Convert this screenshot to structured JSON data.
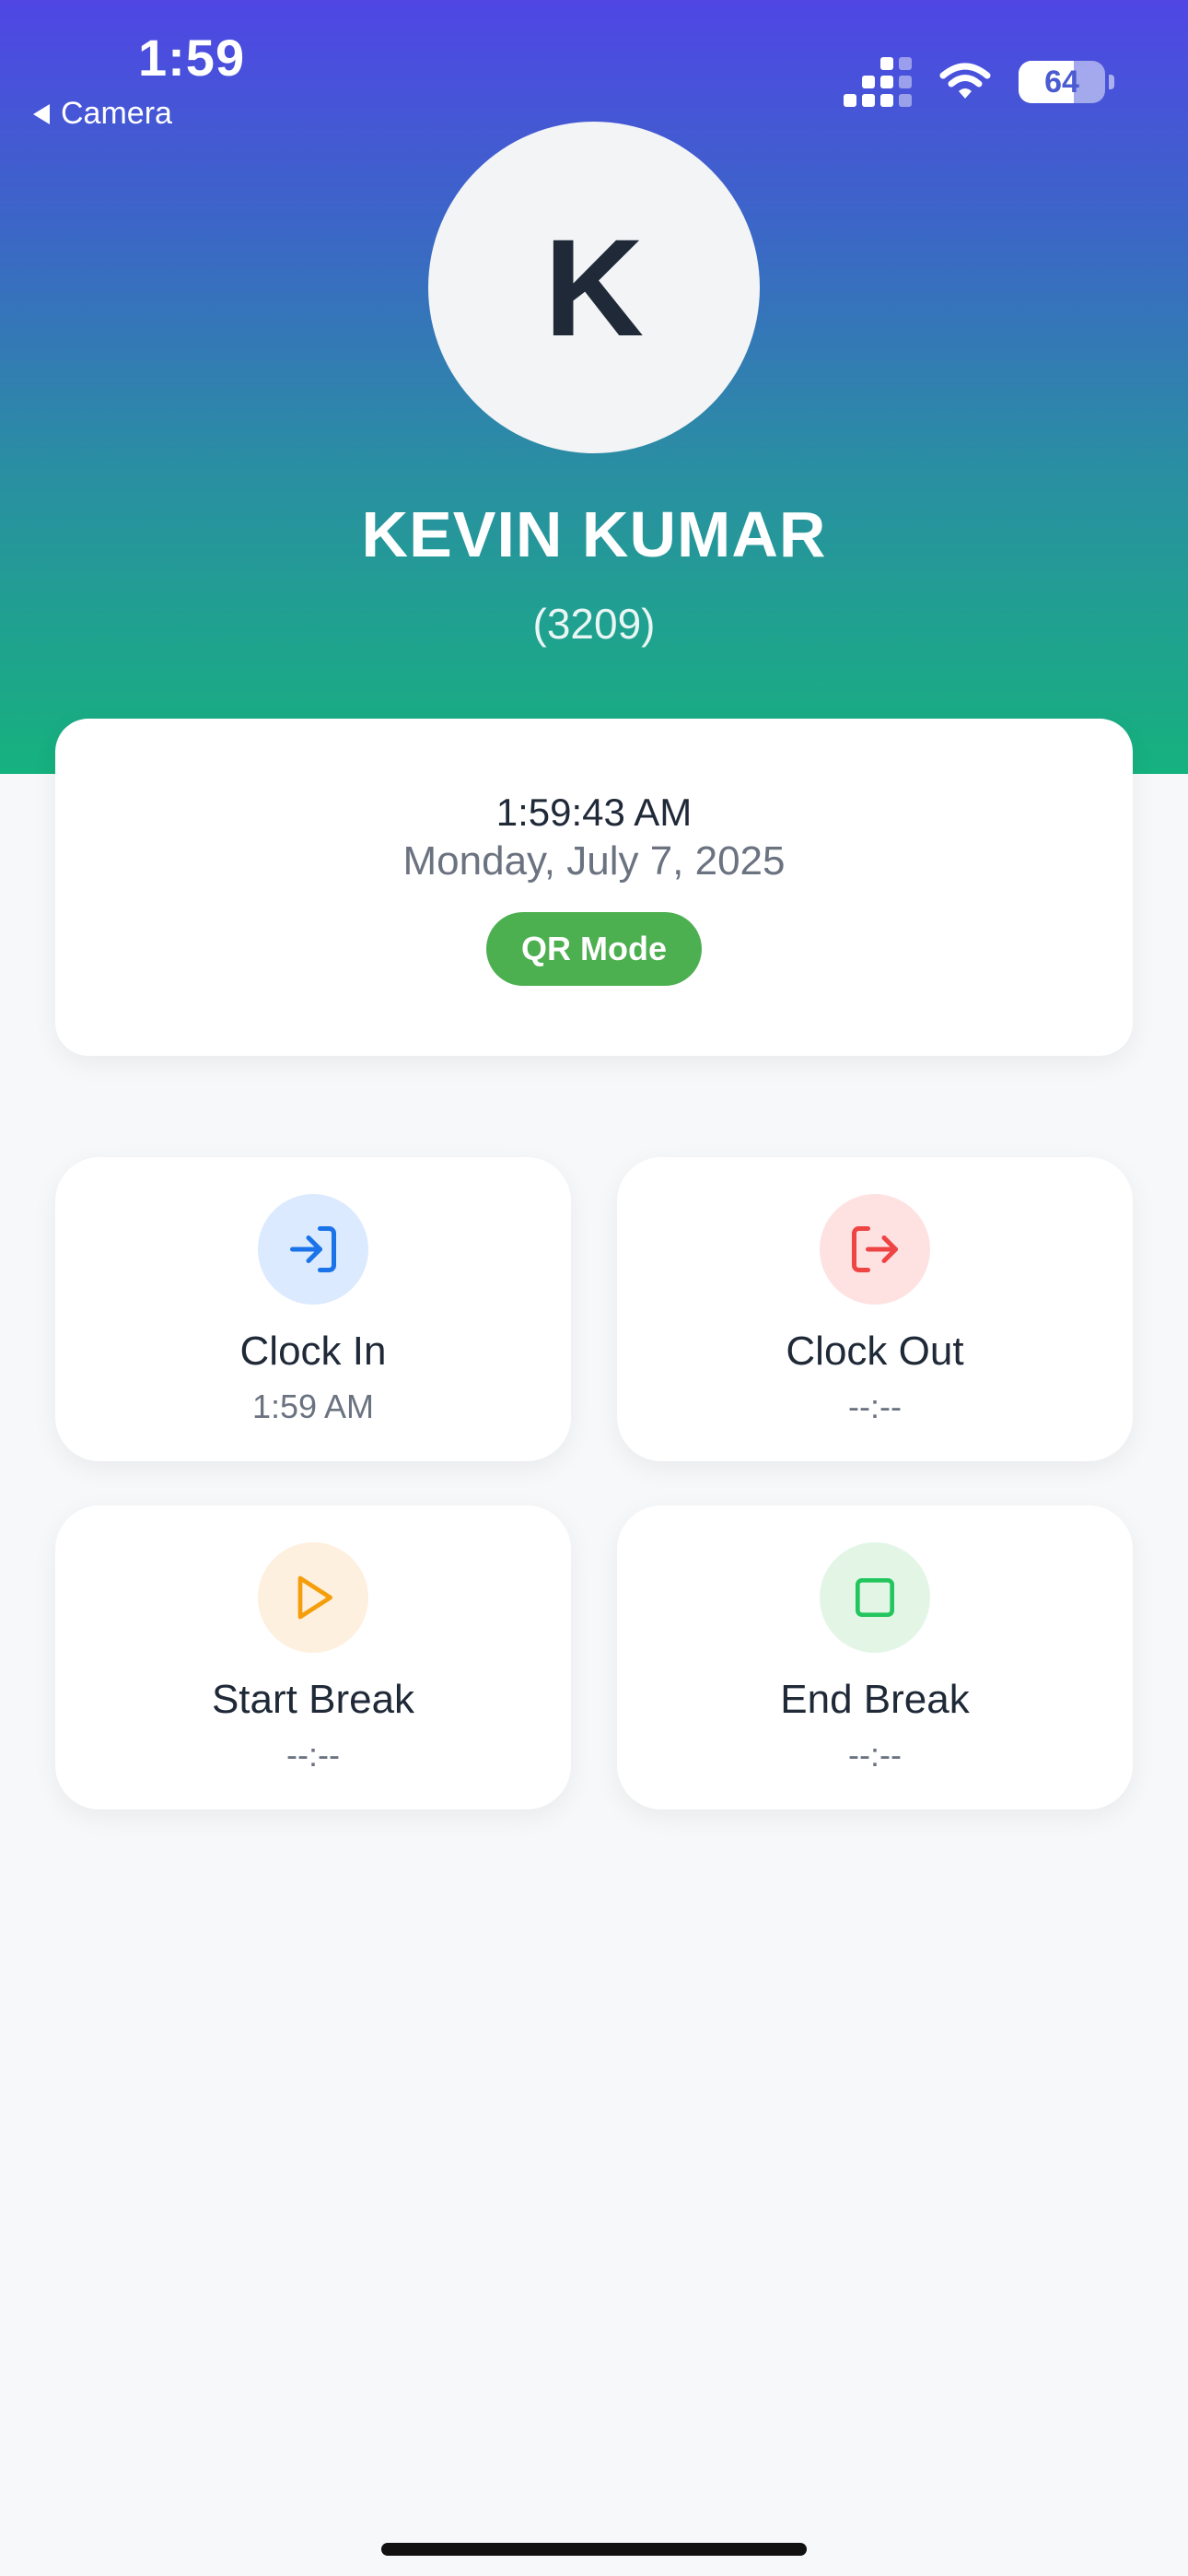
{
  "status_bar": {
    "time": "1:59",
    "back_label": "Camera",
    "battery": "64"
  },
  "profile": {
    "initial": "K",
    "name": "KEVIN KUMAR",
    "employee_id": "(3209)"
  },
  "clock_card": {
    "time": "1:59:43 AM",
    "date": "Monday, July 7, 2025",
    "mode_badge": "QR Mode"
  },
  "actions": [
    {
      "label": "Clock In",
      "value": "1:59 AM",
      "icon": "clock-in-icon",
      "color": "#1a73e8",
      "bg": "#dbeafe"
    },
    {
      "label": "Clock Out",
      "value": "--:--",
      "icon": "clock-out-icon",
      "color": "#ef4444",
      "bg": "#fee2e2"
    },
    {
      "label": "Start Break",
      "value": "--:--",
      "icon": "play-icon",
      "color": "#f59e0b",
      "bg": "#fef0df"
    },
    {
      "label": "End Break",
      "value": "--:--",
      "icon": "stop-icon",
      "color": "#22c55e",
      "bg": "#e3f6e6"
    }
  ],
  "colors": {
    "header_gradient_top": "#4f46e5",
    "header_gradient_bottom": "#16b27e",
    "qr_badge": "#4caf50",
    "page_bg": "#f7f8fa"
  }
}
